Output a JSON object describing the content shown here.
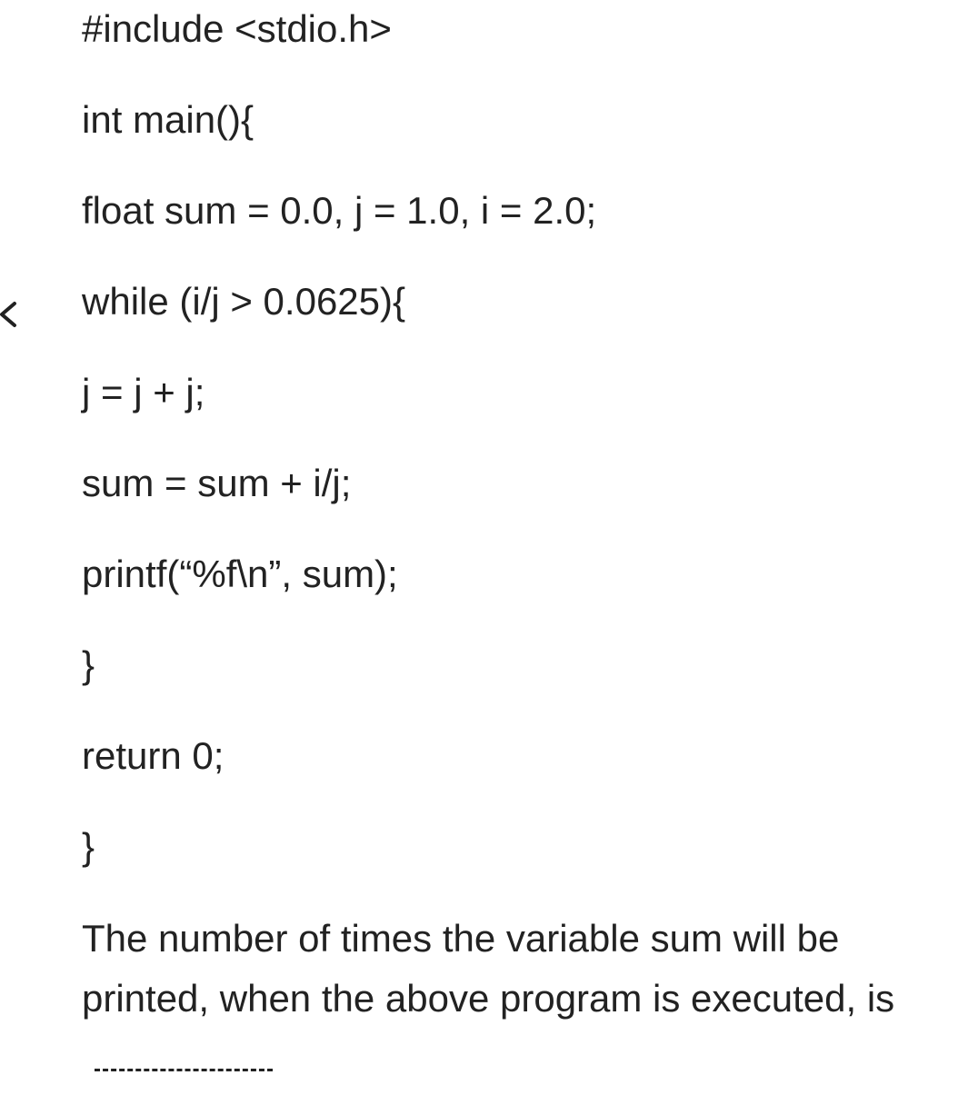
{
  "code": {
    "lines": [
      "#include <stdio.h>",
      "int main(){",
      "float sum = 0.0, j = 1.0, i = 2.0;",
      "while (i/j > 0.0625){",
      "j = j + j;",
      "sum = sum + i/j;",
      "printf(“%f\\n”, sum);",
      "}",
      "return 0;",
      "}"
    ]
  },
  "question": {
    "text": "The number of times the variable sum will be printed, when the above program is executed, is"
  },
  "icons": {
    "back": "chevron-left-icon"
  },
  "colors": {
    "text": "#222222",
    "background": "#ffffff"
  }
}
